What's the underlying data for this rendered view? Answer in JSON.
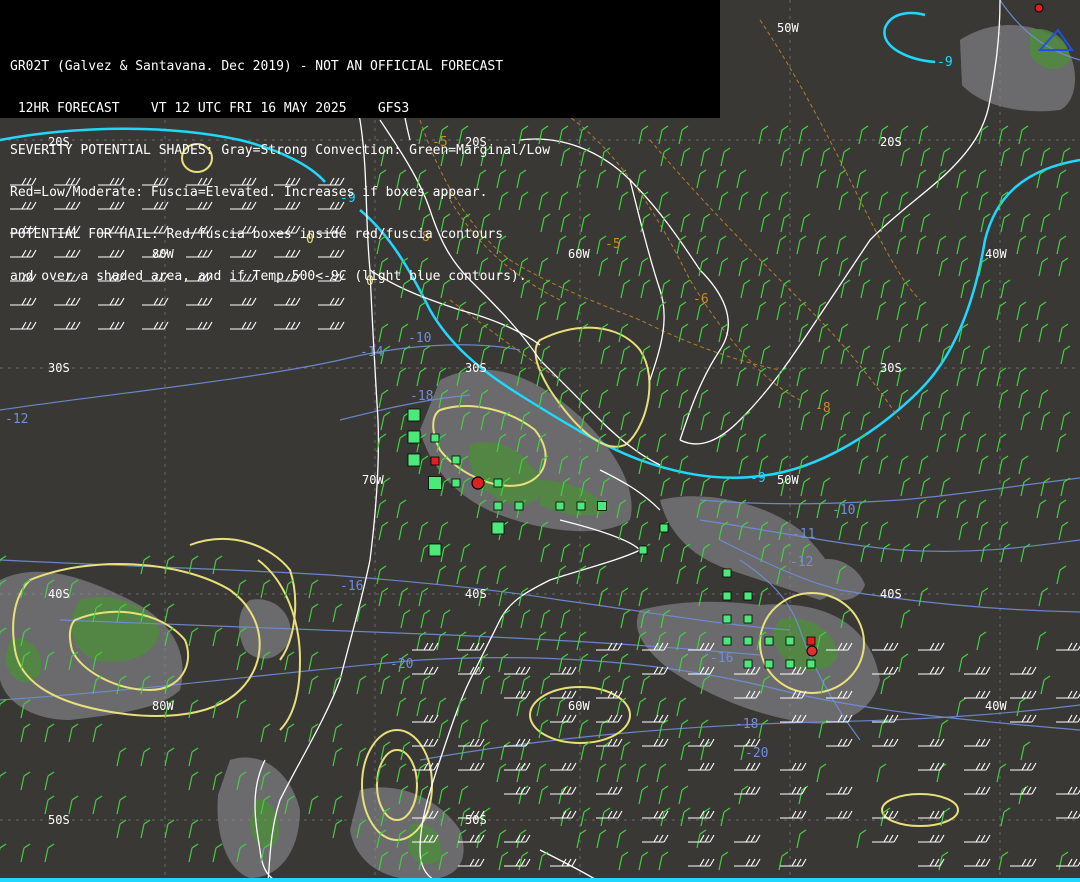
{
  "header": {
    "lines": [
      "GR02T (Galvez & Santavana. Dec 2019) - NOT AN OFFICIAL FORECAST",
      " 12HR FORECAST    VT 12 UTC FRI 16 MAY 2025    GFS3",
      "SEVERITY POTENTIAL SHADES: Gray=Strong Convection: Green=Marginal/Low",
      "Red=Low/Moderate: Fuscia=Elevated. Increases if boxes appear.",
      "POTENTIAL FOR HAIL: Red/fuscia boxes inside red/fuscia contours",
      "and over a shaded area, and if Temp 500<-9C (light blue contours)."
    ]
  },
  "lat_labels": [
    "20S",
    "20S",
    "20S",
    "30S",
    "30S",
    "30S",
    "40S",
    "40S",
    "40S",
    "50S",
    "50S"
  ],
  "lon_labels": [
    "50W",
    "80W",
    "60W",
    "40W",
    "70W",
    "50W",
    "80W",
    "60W",
    "40W"
  ],
  "temp_labels": [
    "-9",
    "-9",
    "-9",
    "-10",
    "-10",
    "-11",
    "-12",
    "-12",
    "-14",
    "-16",
    "-16",
    "-18",
    "-18",
    "-20",
    "-20",
    "-5",
    "-5",
    "-6",
    "-8",
    "-8",
    "0",
    "0"
  ],
  "colors": {
    "background": "#3a3835",
    "coast": "#ffffff",
    "minus9_contour": "#1fd8ff",
    "temp_contour": "#6f8fd8",
    "jet_contour": "#e8e07a",
    "freezing_contour": "#c98a2a",
    "gray_shade": "#6e6e72",
    "green_shade": "#4f8a3e",
    "wind_barb": "#3cd43c",
    "box_green": "#4de87a",
    "box_red": "#e02020"
  }
}
